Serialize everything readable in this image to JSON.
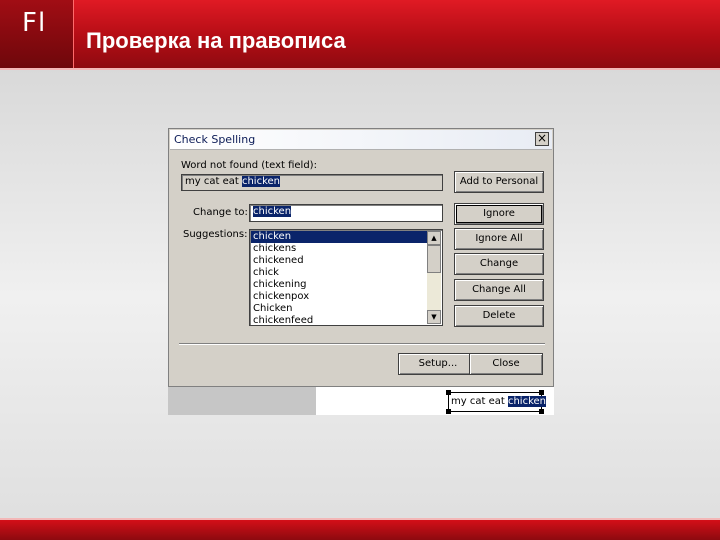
{
  "slide": {
    "logo": "Fl",
    "title": "Проверка на правописа"
  },
  "dialog": {
    "title": "Check Spelling",
    "close_glyph": "×",
    "word_not_found_label": "Word not found (text field):",
    "context_prefix": "my cat eat ",
    "context_word": "chicken",
    "change_to_label": "Change to:",
    "change_to_value": "chicken",
    "suggestions_label": "Suggestions:",
    "suggestions": [
      "chicken",
      "chickens",
      "chickened",
      "chick",
      "chickening",
      "chickenpox",
      "Chicken",
      "chickenfeed"
    ],
    "selected_suggestion_index": 0,
    "buttons": {
      "add_to_personal": "Add to Personal",
      "ignore": "Ignore",
      "ignore_all": "Ignore All",
      "change": "Change",
      "change_all": "Change All",
      "delete": "Delete",
      "setup": "Setup...",
      "close": "Close"
    },
    "scroll_up_glyph": "▲",
    "scroll_down_glyph": "▼"
  },
  "preview": {
    "prefix": "my cat eat ",
    "highlighted_word": "chicken"
  },
  "colors": {
    "header_red": "#c8101a",
    "selection_blue": "#0a246a",
    "dialog_gray": "#d4d0c8"
  }
}
